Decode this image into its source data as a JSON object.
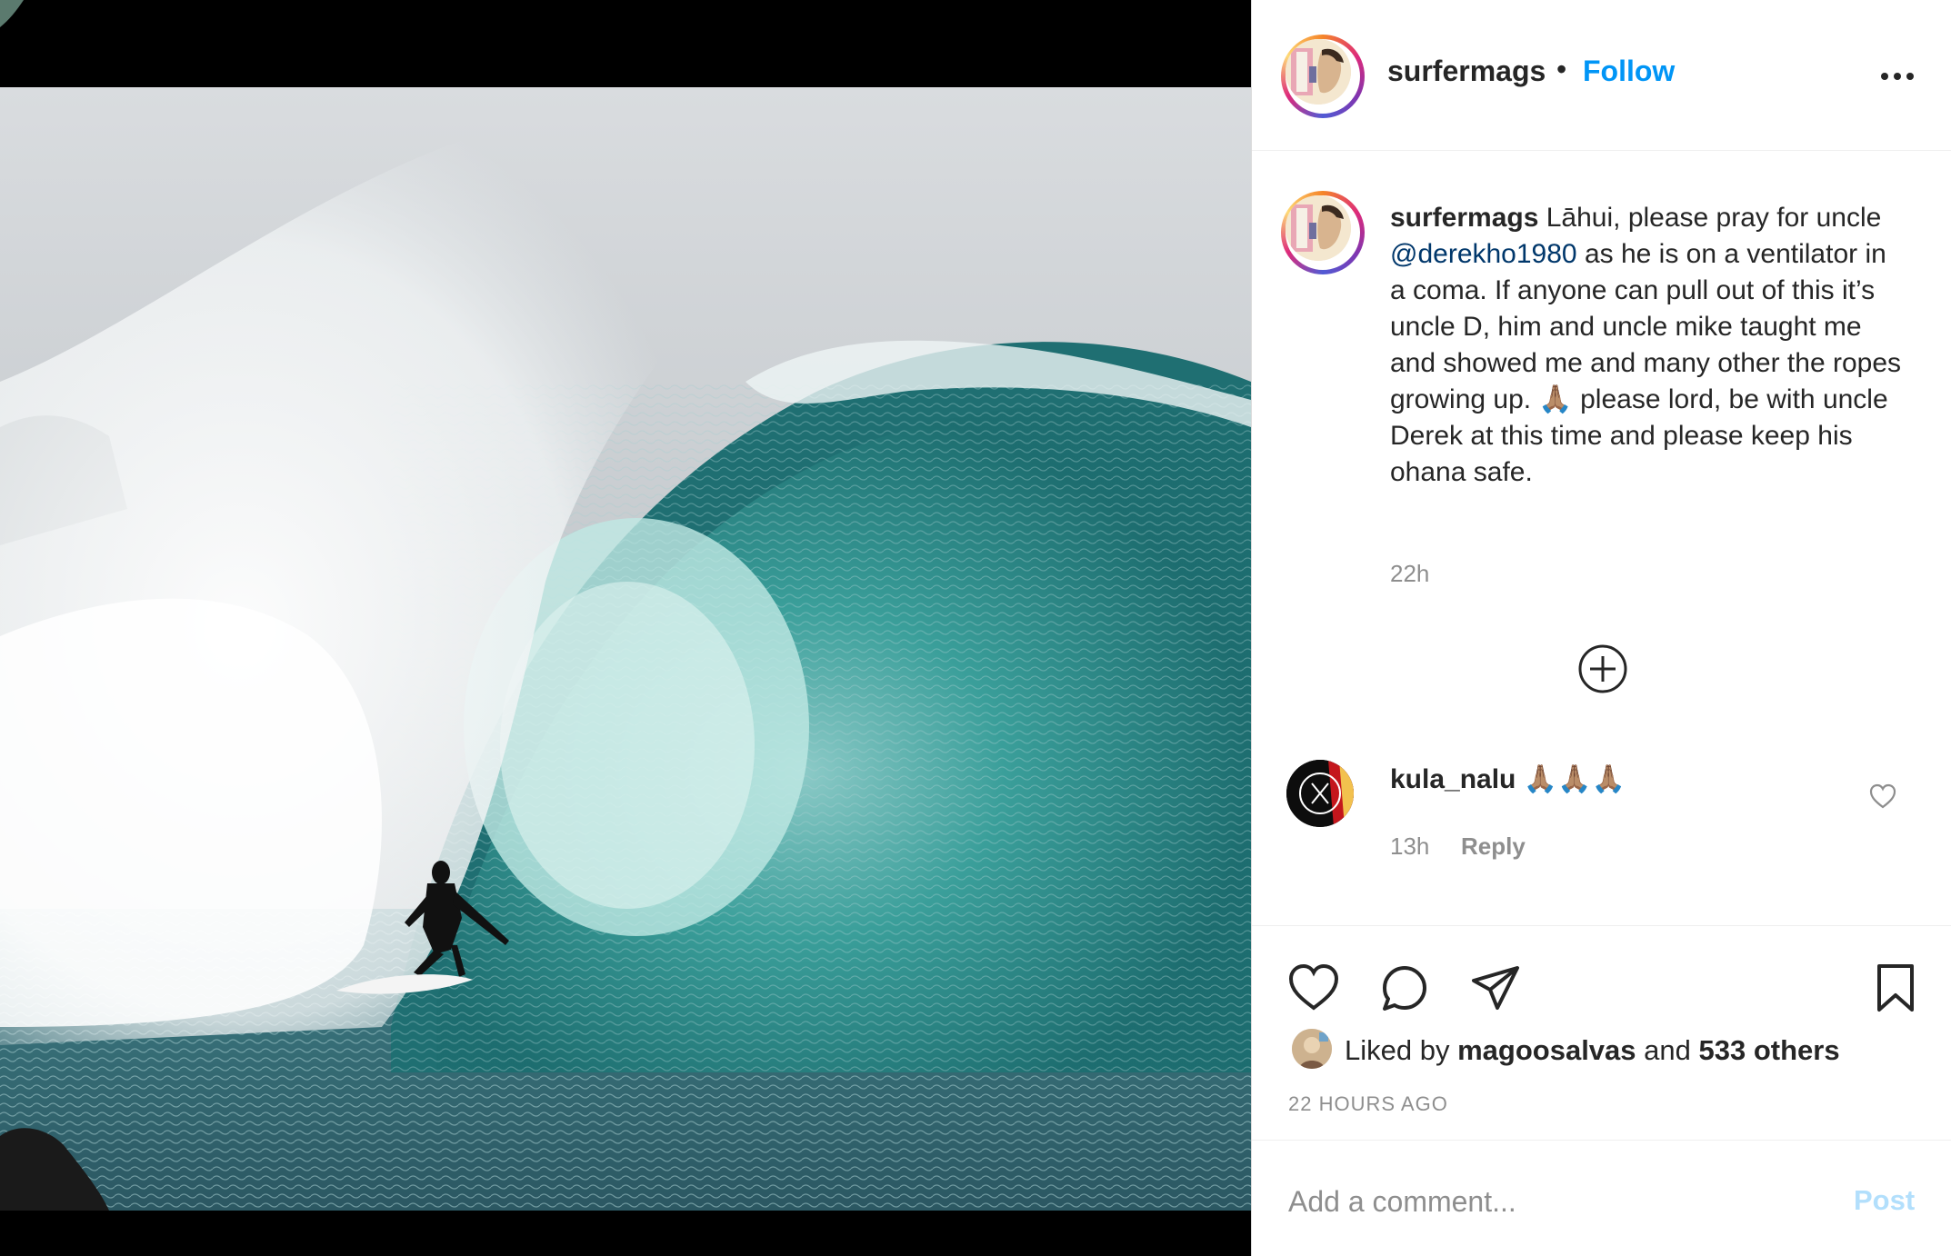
{
  "post": {
    "username": "surfermags",
    "dot": "•",
    "follow_label": "Follow",
    "more_icon": "more-horizontal-icon"
  },
  "caption": {
    "username": "surfermags",
    "text_before_mention": " Lāhui, please pray for uncle ",
    "mention": "@derekho1980",
    "text_after_mention": " as he is on a ventilator in a coma. If anyone can pull out of this it’s uncle D, him and uncle mike taught me and showed me and many other the ropes growing up. 🙏🏽 please lord, be with uncle Derek at this time and please keep his ohana safe.",
    "time": "22h"
  },
  "load_more_icon": "plus-circle-icon",
  "comments": [
    {
      "username": "kula_nalu",
      "text": "🙏🏽🙏🏽🙏🏽",
      "time": "13h",
      "reply_label": "Reply"
    }
  ],
  "actions": {
    "like_icon": "heart-icon",
    "comment_icon": "comment-icon",
    "share_icon": "share-icon",
    "save_icon": "bookmark-icon"
  },
  "likes": {
    "prefix": "Liked by",
    "user": "magoosalvas",
    "and": "and",
    "others": "533 others"
  },
  "posted_ago": "22 HOURS AGO",
  "add_comment": {
    "placeholder": "Add a comment...",
    "post_label": "Post"
  },
  "colors": {
    "link": "#0095f6",
    "mention": "#00376b",
    "muted": "#8e8e8e",
    "post_disabled": "#b2dffc"
  }
}
